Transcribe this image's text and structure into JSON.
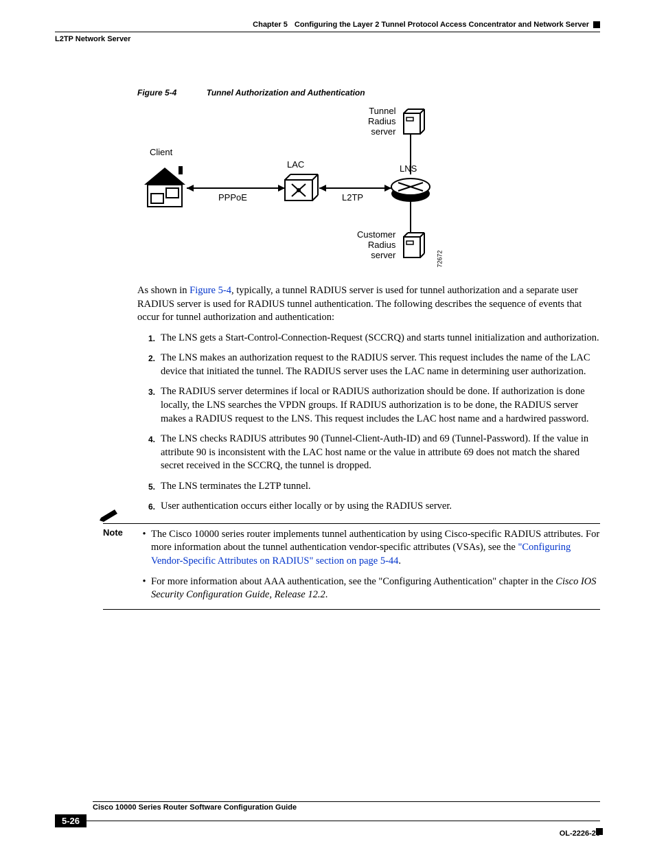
{
  "header": {
    "chapter_prefix": "Chapter 5",
    "chapter_title": "Configuring the Layer 2 Tunnel Protocol Access Concentrator and Network Server",
    "section": "L2TP Network Server"
  },
  "figure": {
    "num": "Figure 5-4",
    "title": "Tunnel Authorization and Authentication",
    "labels": {
      "client": "Client",
      "lac": "LAC",
      "lns": "LNS",
      "pppoe": "PPPoE",
      "l2tp": "L2TP",
      "tunnel_radius": "Tunnel\nRadius\nserver",
      "customer_radius": "Customer\nRadius\nserver",
      "id": "72672"
    }
  },
  "intro": {
    "before_link": "As shown in ",
    "link": "Figure 5-4",
    "after_link": ", typically, a tunnel RADIUS server is used for tunnel authorization and a separate user RADIUS server is used for RADIUS tunnel authentication. The following describes the sequence of events that occur for tunnel authorization and authentication:"
  },
  "steps": [
    "The LNS gets a Start-Control-Connection-Request (SCCRQ) and starts tunnel initialization and authorization.",
    "The LNS makes an authorization request to the RADIUS server. This request includes the name of the LAC device that initiated the tunnel. The RADIUS server uses the LAC name in determining user authorization.",
    "The RADIUS server determines if local or RADIUS authorization should be done. If authorization is done locally, the LNS searches the VPDN groups. If RADIUS authorization is to be done, the RADIUS server makes a RADIUS request to the LNS. This request includes the LAC host name and a hardwired password.",
    "The LNS checks RADIUS attributes 90 (Tunnel-Client-Auth-ID) and 69 (Tunnel-Password). If the value in attribute 90 is inconsistent with the LAC host name or the value in attribute 69 does not match the shared secret received in the SCCRQ, the tunnel is dropped.",
    "The LNS terminates the L2TP tunnel.",
    "User authentication occurs either locally or by using the RADIUS server."
  ],
  "note": {
    "label": "Note",
    "bullet1_before": "The Cisco 10000 series router implements tunnel authentication by using Cisco-specific RADIUS attributes. For more information about the tunnel authentication vendor-specific attributes (VSAs), see the ",
    "bullet1_link": "\"Configuring Vendor-Specific Attributes on RADIUS\" section on page 5-44",
    "bullet1_after": ".",
    "bullet2_before": "For more information about AAA authentication, see the \"Configuring Authentication\" chapter in the ",
    "bullet2_italic": "Cisco IOS Security Configuration Guide, Release 12.2",
    "bullet2_after": "."
  },
  "footer": {
    "guide": "Cisco 10000 Series Router Software Configuration Guide",
    "page": "5-26",
    "docid": "OL-2226-23"
  }
}
